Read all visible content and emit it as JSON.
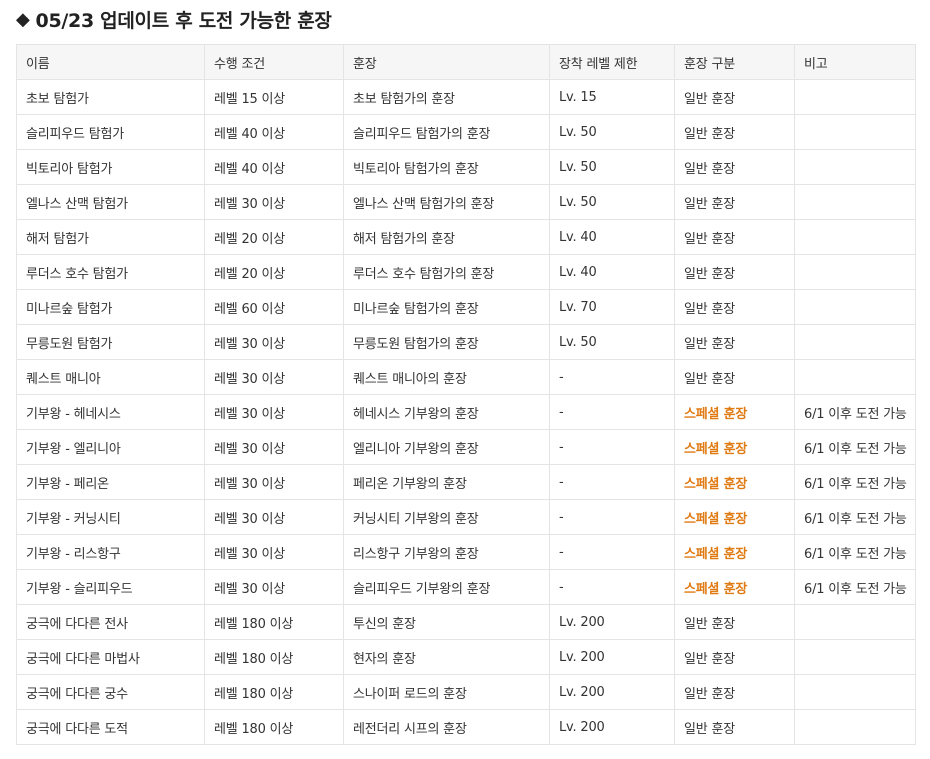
{
  "page": {
    "title": "05/23 업데이트 후 도전 가능한 훈장",
    "title_icon": "diamond-icon"
  },
  "colors": {
    "special": "#e07a12"
  },
  "table": {
    "headers": [
      "이름",
      "수행 조건",
      "훈장",
      "장착 레벨 제한",
      "훈장 구분",
      "비고"
    ],
    "rows": [
      {
        "name": "초보 탐험가",
        "cond": "레벨 15 이상",
        "medal": "초보 탐험가의 훈장",
        "level": "Lv. 15",
        "type": "일반 훈장",
        "note": "",
        "special": false
      },
      {
        "name": "슬리피우드 탐험가",
        "cond": "레벨 40 이상",
        "medal": "슬리피우드 탐험가의 훈장",
        "level": "Lv. 50",
        "type": "일반 훈장",
        "note": "",
        "special": false
      },
      {
        "name": "빅토리아 탐험가",
        "cond": "레벨 40 이상",
        "medal": "빅토리아 탐험가의 훈장",
        "level": "Lv. 50",
        "type": "일반 훈장",
        "note": "",
        "special": false
      },
      {
        "name": "엘나스 산맥 탐험가",
        "cond": "레벨 30 이상",
        "medal": "엘나스 산맥 탐험가의 훈장",
        "level": "Lv. 50",
        "type": "일반 훈장",
        "note": "",
        "special": false
      },
      {
        "name": "해저 탐험가",
        "cond": "레벨 20 이상",
        "medal": "해저 탐험가의 훈장",
        "level": "Lv. 40",
        "type": "일반 훈장",
        "note": "",
        "special": false
      },
      {
        "name": "루더스 호수 탐험가",
        "cond": "레벨 20 이상",
        "medal": "루더스 호수 탐험가의 훈장",
        "level": "Lv. 40",
        "type": "일반 훈장",
        "note": "",
        "special": false
      },
      {
        "name": "미나르숲 탐험가",
        "cond": "레벨 60 이상",
        "medal": "미나르숲 탐험가의 훈장",
        "level": "Lv. 70",
        "type": "일반 훈장",
        "note": "",
        "special": false
      },
      {
        "name": "무릉도원 탐험가",
        "cond": "레벨 30 이상",
        "medal": "무릉도원 탐험가의 훈장",
        "level": "Lv. 50",
        "type": "일반 훈장",
        "note": "",
        "special": false
      },
      {
        "name": "퀘스트 매니아",
        "cond": "레벨 30 이상",
        "medal": "퀘스트 매니아의 훈장",
        "level": "-",
        "type": "일반 훈장",
        "note": "",
        "special": false
      },
      {
        "name": "기부왕 - 헤네시스",
        "cond": "레벨 30 이상",
        "medal": "헤네시스 기부왕의 훈장",
        "level": "-",
        "type": "스페셜 훈장",
        "note": "6/1 이후 도전 가능",
        "special": true
      },
      {
        "name": "기부왕 - 엘리니아",
        "cond": "레벨 30 이상",
        "medal": "엘리니아 기부왕의 훈장",
        "level": "-",
        "type": "스페셜 훈장",
        "note": "6/1 이후 도전 가능",
        "special": true
      },
      {
        "name": "기부왕 - 페리온",
        "cond": "레벨 30 이상",
        "medal": "페리온 기부왕의 훈장",
        "level": "-",
        "type": "스페셜 훈장",
        "note": "6/1 이후 도전 가능",
        "special": true
      },
      {
        "name": "기부왕 - 커닝시티",
        "cond": "레벨 30 이상",
        "medal": "커닝시티 기부왕의 훈장",
        "level": "-",
        "type": "스페셜 훈장",
        "note": "6/1 이후 도전 가능",
        "special": true
      },
      {
        "name": "기부왕 - 리스항구",
        "cond": "레벨 30 이상",
        "medal": "리스항구 기부왕의 훈장",
        "level": "-",
        "type": "스페셜 훈장",
        "note": "6/1 이후 도전 가능",
        "special": true
      },
      {
        "name": "기부왕 - 슬리피우드",
        "cond": "레벨 30 이상",
        "medal": "슬리피우드 기부왕의 훈장",
        "level": "-",
        "type": "스페셜 훈장",
        "note": "6/1 이후 도전 가능",
        "special": true
      },
      {
        "name": "궁극에 다다른 전사",
        "cond": "레벨 180 이상",
        "medal": "투신의 훈장",
        "level": "Lv. 200",
        "type": "일반 훈장",
        "note": "",
        "special": false
      },
      {
        "name": "궁극에 다다른 마법사",
        "cond": "레벨 180 이상",
        "medal": "현자의 훈장",
        "level": "Lv. 200",
        "type": "일반 훈장",
        "note": "",
        "special": false
      },
      {
        "name": "궁극에 다다른 궁수",
        "cond": "레벨 180 이상",
        "medal": "스나이퍼 로드의 훈장",
        "level": "Lv. 200",
        "type": "일반 훈장",
        "note": "",
        "special": false
      },
      {
        "name": "궁극에 다다른 도적",
        "cond": "레벨 180 이상",
        "medal": "레전더리 시프의 훈장",
        "level": "Lv. 200",
        "type": "일반 훈장",
        "note": "",
        "special": false
      }
    ]
  }
}
